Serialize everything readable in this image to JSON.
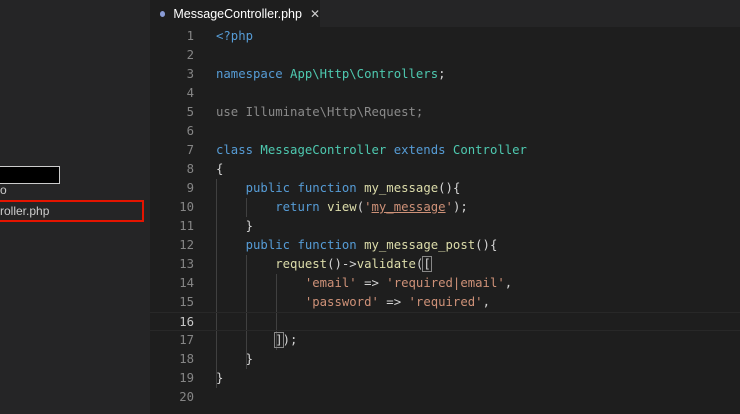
{
  "sidebar": {
    "letter": "o",
    "file_label": "roller.php"
  },
  "tab": {
    "label": "MessageController.php",
    "close": "✕"
  },
  "colors": {
    "highlight_border": "#e51400",
    "keyword": "#569cd6",
    "class": "#4ec9b0",
    "function": "#dcdcaa",
    "string": "#ce9178"
  },
  "editor": {
    "lines": [
      {
        "n": "1",
        "tokens": [
          {
            "t": "<?php",
            "c": "t-kw"
          }
        ]
      },
      {
        "n": "2",
        "tokens": []
      },
      {
        "n": "3",
        "tokens": [
          {
            "t": "namespace ",
            "c": "t-kw"
          },
          {
            "t": "App\\Http\\Controllers",
            "c": "t-cls"
          },
          {
            "t": ";",
            "c": "t-plain"
          }
        ]
      },
      {
        "n": "4",
        "tokens": []
      },
      {
        "n": "5",
        "tokens": [
          {
            "t": "use ",
            "c": "t-kw t-dim"
          },
          {
            "t": "Illuminate\\Http\\",
            "c": "t-dim"
          },
          {
            "t": "Request",
            "c": "t-cls t-dim"
          },
          {
            "t": ";",
            "c": "t-dim"
          }
        ]
      },
      {
        "n": "6",
        "tokens": []
      },
      {
        "n": "7",
        "tokens": [
          {
            "t": "class ",
            "c": "t-kw"
          },
          {
            "t": "MessageController ",
            "c": "t-cls"
          },
          {
            "t": "extends ",
            "c": "t-kw"
          },
          {
            "t": "Controller",
            "c": "t-cls"
          }
        ]
      },
      {
        "n": "8",
        "tokens": [
          {
            "t": "{",
            "c": "t-plain"
          }
        ]
      },
      {
        "n": "9",
        "tokens": [
          {
            "t": "    ",
            "c": "t-plain"
          },
          {
            "t": "public ",
            "c": "t-kw"
          },
          {
            "t": "function ",
            "c": "t-kw"
          },
          {
            "t": "my_message",
            "c": "t-fn"
          },
          {
            "t": "(){",
            "c": "t-plain"
          }
        ]
      },
      {
        "n": "10",
        "tokens": [
          {
            "t": "        ",
            "c": "t-plain"
          },
          {
            "t": "return ",
            "c": "t-kw"
          },
          {
            "t": "view",
            "c": "t-fn"
          },
          {
            "t": "(",
            "c": "t-plain"
          },
          {
            "t": "'",
            "c": "t-str"
          },
          {
            "t": "my_message",
            "c": "t-red"
          },
          {
            "t": "'",
            "c": "t-str"
          },
          {
            "t": ");",
            "c": "t-plain"
          }
        ]
      },
      {
        "n": "11",
        "tokens": [
          {
            "t": "    }",
            "c": "t-plain"
          }
        ]
      },
      {
        "n": "12",
        "tokens": [
          {
            "t": "    ",
            "c": "t-plain"
          },
          {
            "t": "public ",
            "c": "t-kw"
          },
          {
            "t": "function ",
            "c": "t-kw"
          },
          {
            "t": "my_message_post",
            "c": "t-fn"
          },
          {
            "t": "(){",
            "c": "t-plain"
          }
        ]
      },
      {
        "n": "13",
        "tokens": [
          {
            "t": "        ",
            "c": "t-plain"
          },
          {
            "t": "request",
            "c": "t-fn"
          },
          {
            "t": "()->",
            "c": "t-plain"
          },
          {
            "t": "validate",
            "c": "t-fn"
          },
          {
            "t": "(",
            "c": "t-plain"
          },
          {
            "t": "[",
            "c": "t-plain bracket"
          }
        ]
      },
      {
        "n": "14",
        "tokens": [
          {
            "t": "            ",
            "c": "t-plain"
          },
          {
            "t": "'email'",
            "c": "t-str"
          },
          {
            "t": " => ",
            "c": "t-plain"
          },
          {
            "t": "'required|email'",
            "c": "t-str"
          },
          {
            "t": ",",
            "c": "t-plain"
          }
        ]
      },
      {
        "n": "15",
        "tokens": [
          {
            "t": "            ",
            "c": "t-plain"
          },
          {
            "t": "'password'",
            "c": "t-str"
          },
          {
            "t": " => ",
            "c": "t-plain"
          },
          {
            "t": "'required'",
            "c": "t-str"
          },
          {
            "t": ",",
            "c": "t-plain"
          }
        ]
      },
      {
        "n": "16",
        "tokens": []
      },
      {
        "n": "17",
        "tokens": [
          {
            "t": "        ",
            "c": "t-plain"
          },
          {
            "t": "]",
            "c": "t-plain bracket"
          },
          {
            "t": ");",
            "c": "t-plain"
          }
        ]
      },
      {
        "n": "18",
        "tokens": [
          {
            "t": "    }",
            "c": "t-plain"
          }
        ]
      },
      {
        "n": "19",
        "tokens": [
          {
            "t": "}",
            "c": "t-plain"
          }
        ]
      },
      {
        "n": "20",
        "tokens": []
      }
    ]
  }
}
